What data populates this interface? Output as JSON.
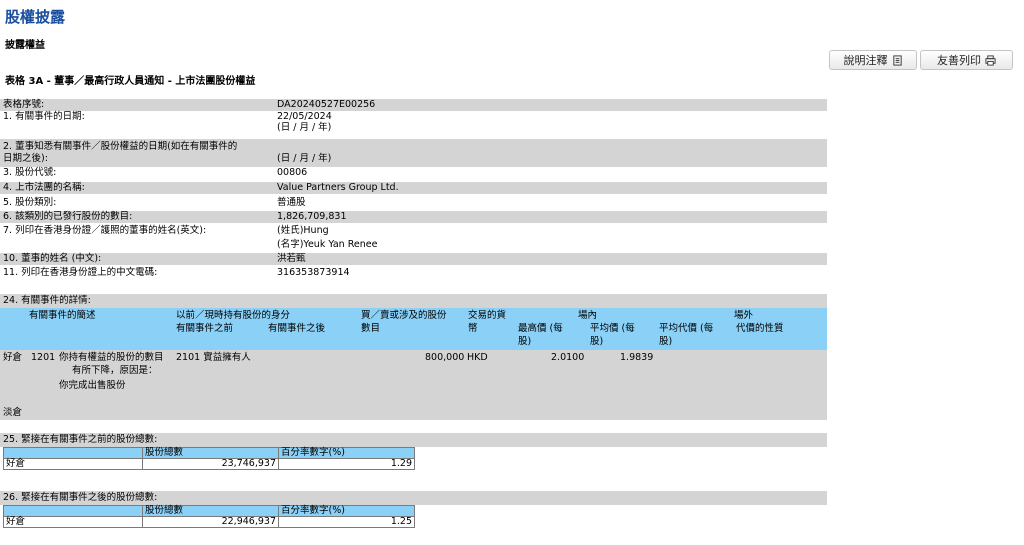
{
  "page": {
    "title": "股權披露",
    "subtitle": "披露權益",
    "form_title": "表格 3A - 董事／最高行政人員通知 - 上市法團股份權益"
  },
  "toolbar": {
    "notes_label": "說明注釋",
    "print_label": "友善列印"
  },
  "form": {
    "serial_label": "表格序號:",
    "serial_value": "DA20240527E00256",
    "q1_label": "1. 有關事件的日期:",
    "q1_value": "22/05/2024",
    "q1_hint": "(日 / 月 / 年)",
    "q2_label_1": "2. 董事知悉有關事件／股份權益的日期(如在有關事件的",
    "q2_label_2": "日期之後):",
    "q2_value": "(日 / 月 / 年)",
    "q3_label": "3. 股份代號:",
    "q3_value": "00806",
    "q4_label": "4. 上市法團的名稱:",
    "q4_value": "Value Partners Group Ltd.",
    "q5_label": "5. 股份類別:",
    "q5_value": "普通股",
    "q6_label": "6. 該類別的已發行股份的數目:",
    "q6_value": "1,826,709,831",
    "q7_label": "7. 列印在香港身份證／護照的董事的姓名(英文):",
    "q7_surname": "(姓氏)Hung",
    "q7_given": "(名字)Yeuk Yan Renee",
    "q10_label": "10. 董事的姓名 (中文):",
    "q10_value": "洪若甄",
    "q11_label": "11. 列印在香港身份證上的中文電碼:",
    "q11_value": "316353873914"
  },
  "section24": {
    "label": "24. 有關事件的詳情:",
    "headers": {
      "event_desc": "有關事件的簡述",
      "capacity": "以前／現時持有股份的身分",
      "before": "有關事件之前",
      "after": "有關事件之後",
      "shares_1": "買／賣或涉及的股份",
      "shares_2": "數目",
      "currency_1": "交易的貨",
      "currency_2": "幣",
      "onex": "場內",
      "offex": "場外",
      "high_1": "最高價 (每",
      "high_2": "股)",
      "avg_1": "平均價 (每",
      "avg_2": "股)",
      "avgc_1": "平均代價 (每",
      "avgc_2": "股)",
      "consid": "代價的性質"
    },
    "row": {
      "position": "好倉",
      "code": "1201",
      "desc_1": "你持有權益的股份的數目",
      "desc_2": "有所下降，原因是：",
      "desc_3": "你完成出售股份",
      "cap_before": "2101 實益擁有人",
      "shares": "800,000",
      "currency": "HKD",
      "high": "2.0100",
      "avg": "1.9839"
    },
    "short_label": "淡倉"
  },
  "section25": {
    "label": "25. 緊接在有關事件之前的股份總數:",
    "col_shares": "股份總數",
    "col_pct": "百分率數字(%)",
    "row_label": "好倉",
    "shares": "23,746,937",
    "pct": "1.29"
  },
  "section26": {
    "label": "26. 緊接在有關事件之後的股份總數:",
    "col_shares": "股份總數",
    "col_pct": "百分率數字(%)",
    "row_label": "好倉",
    "shares": "22,946,937",
    "pct": "1.25"
  }
}
